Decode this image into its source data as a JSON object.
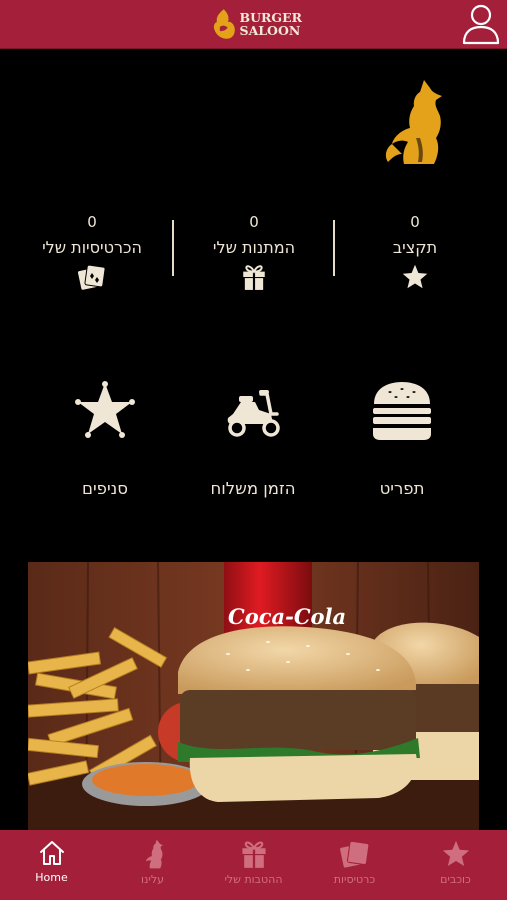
{
  "app": {
    "logo_line1": "BURGER",
    "logo_line2": "SALOON"
  },
  "stats": [
    {
      "value": "0",
      "label": "תקציב",
      "icon": "star-icon"
    },
    {
      "value": "0",
      "label": "המתנות שלי",
      "icon": "gift-icon"
    },
    {
      "value": "0",
      "label": "הכרטיסיות שלי",
      "icon": "cards-icon"
    }
  ],
  "actions": [
    {
      "label": "תפריט",
      "icon": "burger-icon"
    },
    {
      "label": "הזמן משלוח",
      "icon": "scooter-icon"
    },
    {
      "label": "סניפים",
      "icon": "sheriff-star-icon"
    }
  ],
  "tabs": [
    {
      "label": "Home",
      "icon": "home-icon",
      "active": true
    },
    {
      "label": "עלינו",
      "icon": "wolf-icon"
    },
    {
      "label": "ההטבות שלי",
      "icon": "gift-icon"
    },
    {
      "label": "כרטיסיות",
      "icon": "cards-icon"
    },
    {
      "label": "כוכבים",
      "icon": "star-icon"
    }
  ],
  "colors": {
    "brand": "#a4203a",
    "accent": "#e3a21a",
    "ink": "#efe6d6"
  },
  "photo": {
    "can_text": "Coca-Cola"
  }
}
